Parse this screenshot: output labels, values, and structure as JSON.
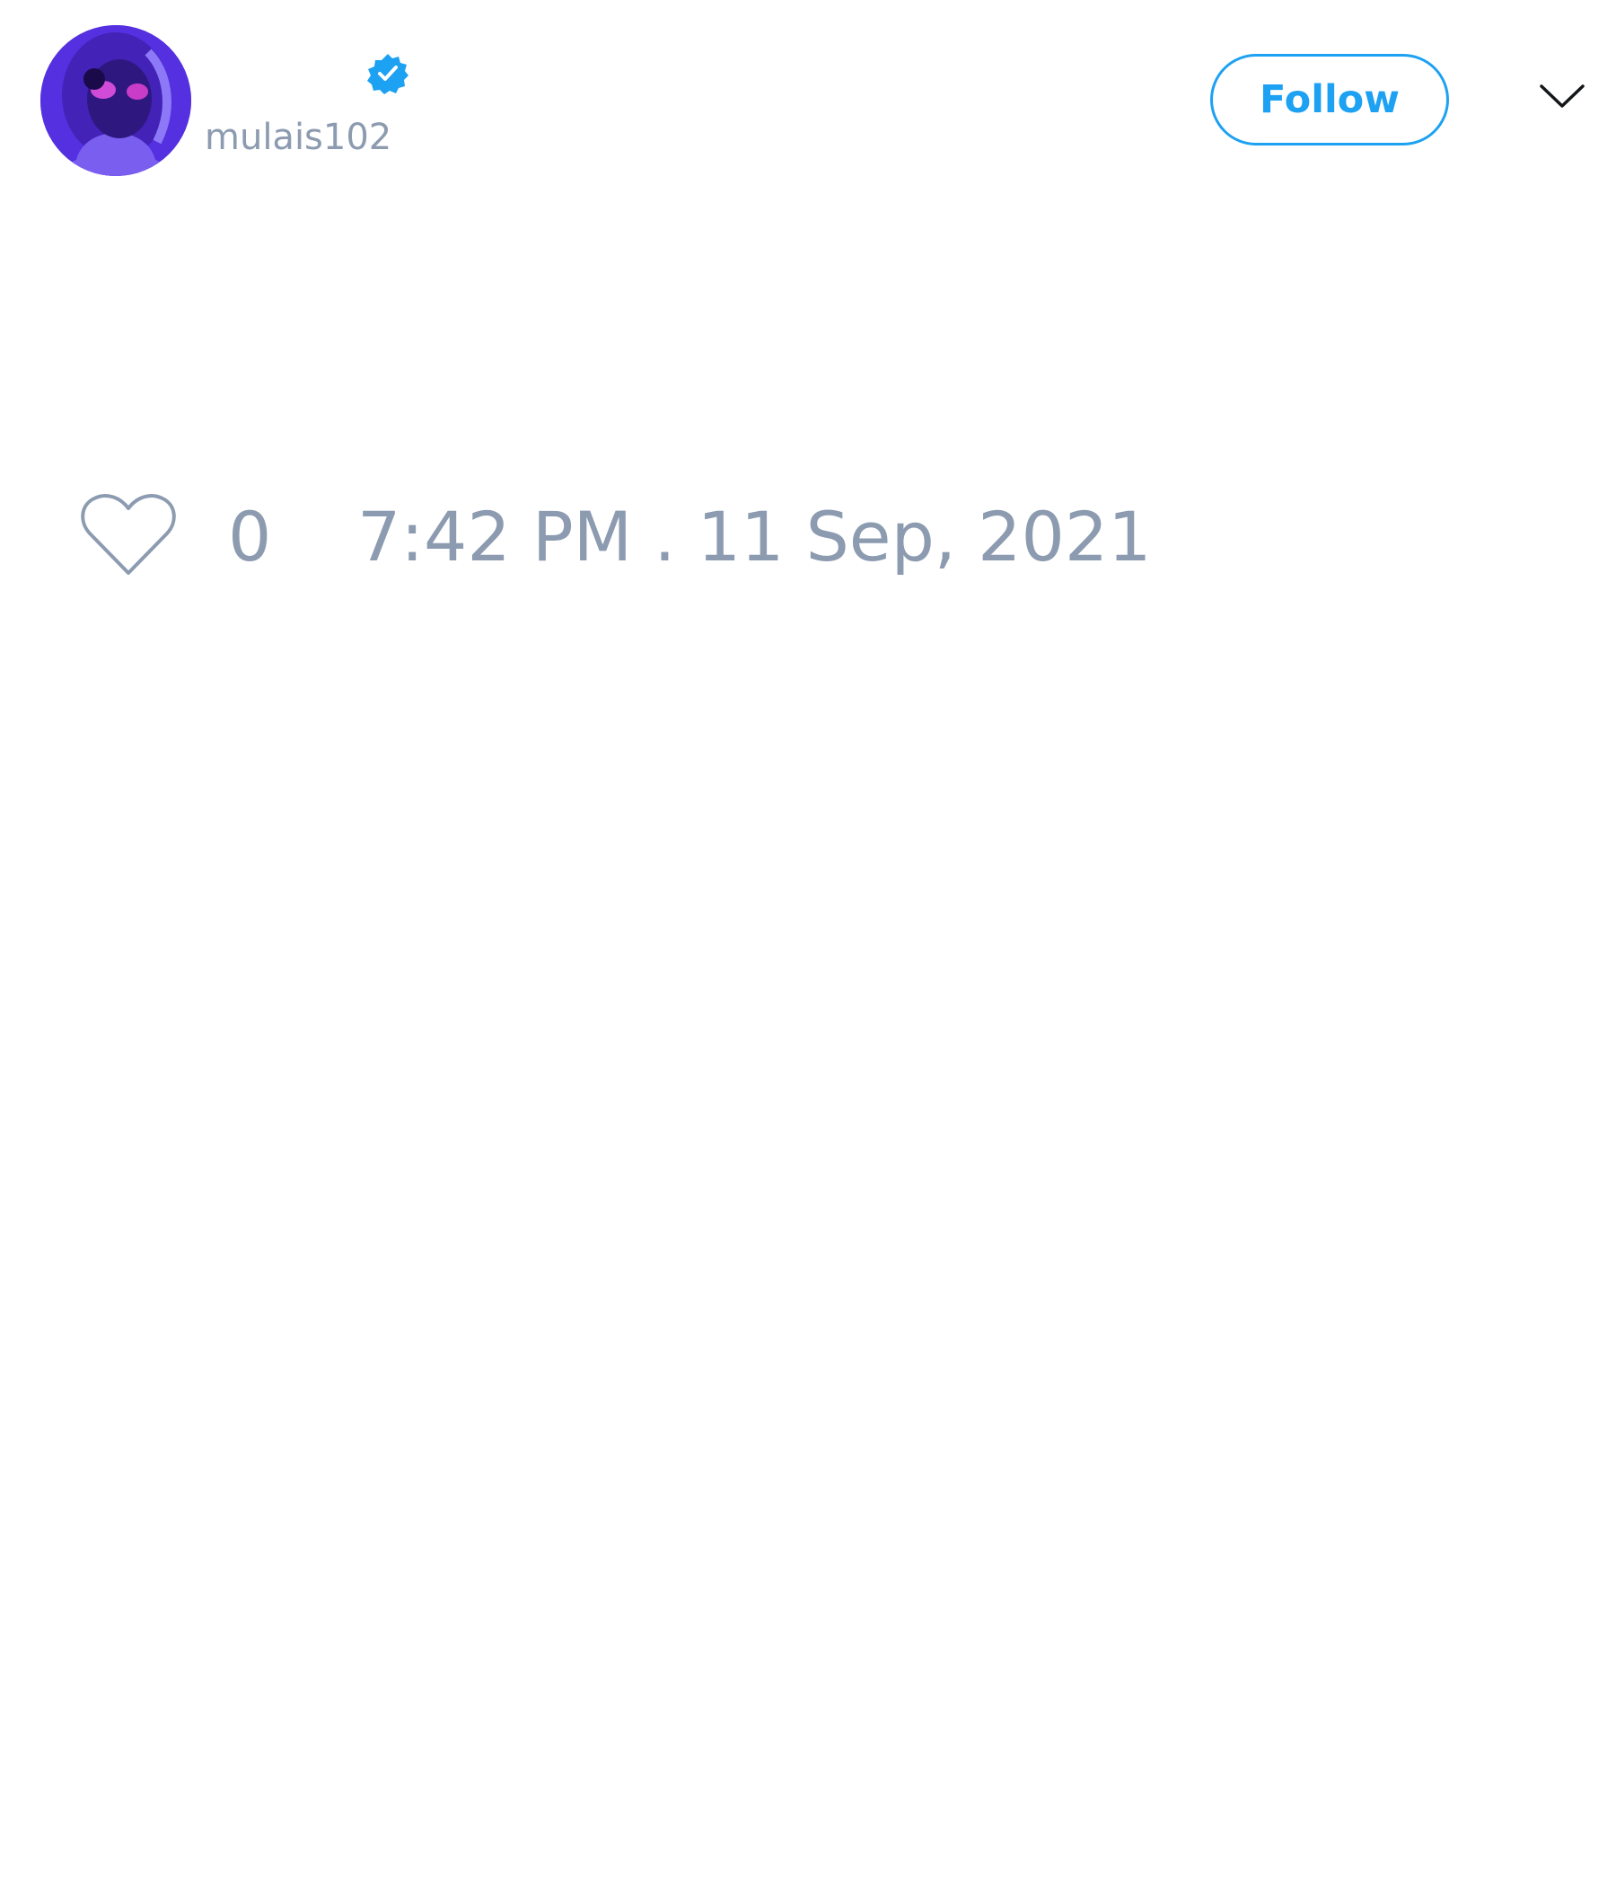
{
  "tweet": {
    "author": {
      "display_name": "",
      "handle": "mulais102",
      "verified": true,
      "avatar_icon": "user-avatar-photo"
    },
    "header": {
      "follow_label": "Follow",
      "menu_icon": "chevron-down-icon"
    },
    "footer": {
      "like_icon": "heart-outline-icon",
      "like_count": "0",
      "timestamp": "7:42 PM . 11 Sep, 2021"
    }
  },
  "colors": {
    "accent": "#1da1f2",
    "muted_text": "#8c9bb0",
    "avatar_background": "#4f2ad8",
    "background": "#ffffff"
  }
}
